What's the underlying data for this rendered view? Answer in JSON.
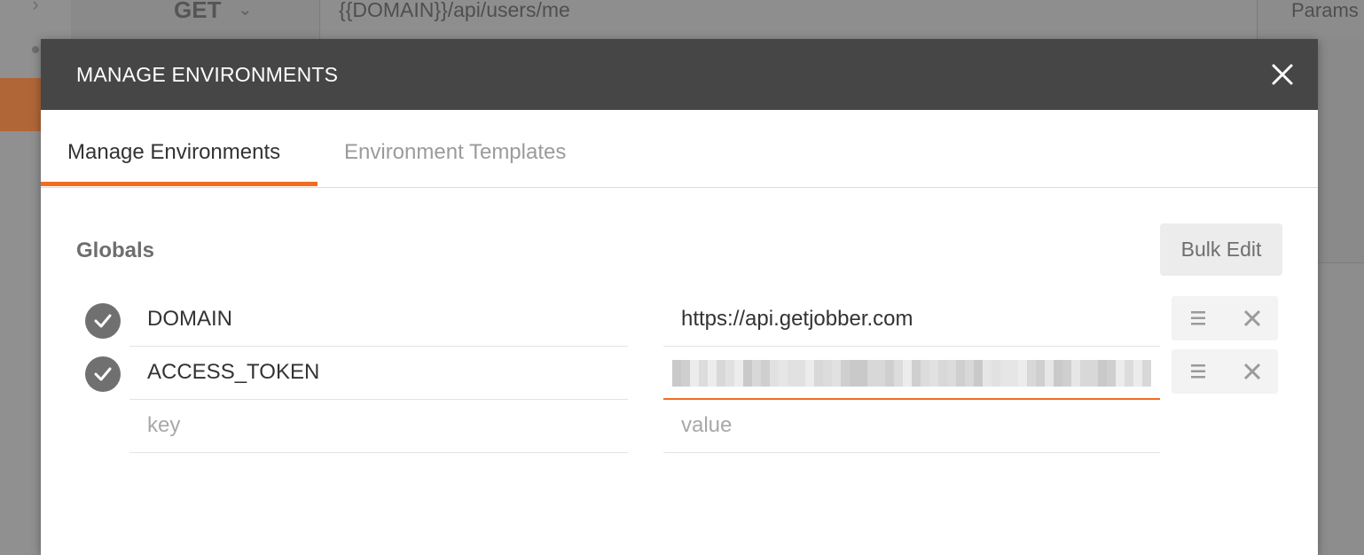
{
  "background": {
    "method": "GET",
    "url": "{{DOMAIN}}/api/users/me",
    "params_label": "Params"
  },
  "modal": {
    "title": "MANAGE ENVIRONMENTS",
    "close_icon": "close-icon",
    "tabs": [
      {
        "label": "Manage Environments",
        "active": true
      },
      {
        "label": "Environment Templates",
        "active": false
      }
    ],
    "section_title": "Globals",
    "bulk_edit_label": "Bulk Edit",
    "variables": [
      {
        "enabled": true,
        "key": "DOMAIN",
        "value": "https://api.getjobber.com",
        "masked": false
      },
      {
        "enabled": true,
        "key": "ACCESS_TOKEN",
        "value": "",
        "masked": true
      }
    ],
    "new_row": {
      "key_placeholder": "key",
      "value_placeholder": "value"
    }
  },
  "colors": {
    "accent": "#f26b21",
    "header_bg": "#464646",
    "checkbox": "#707070"
  }
}
